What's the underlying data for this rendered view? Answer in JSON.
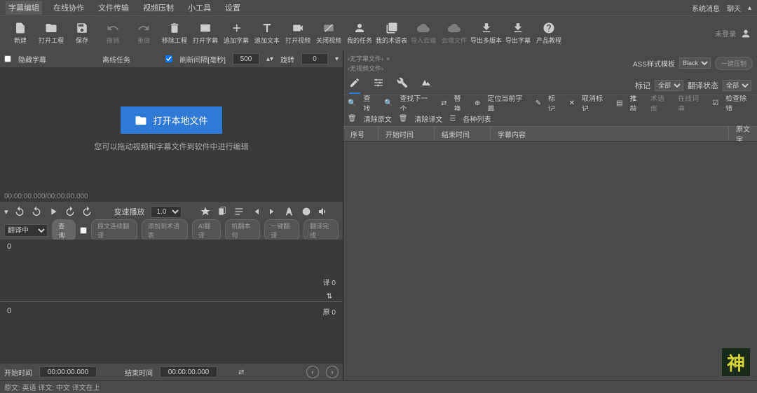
{
  "top": {
    "tabs": [
      "字幕编辑",
      "在线协作",
      "文件传输",
      "视频压制",
      "小工具",
      "设置"
    ],
    "right": {
      "msg": "系统消息",
      "chat": "聊天",
      "login": "未登录"
    }
  },
  "toolbar": [
    {
      "label": "新建"
    },
    {
      "label": "打开工程"
    },
    {
      "label": "保存"
    },
    {
      "label": "撤销",
      "disabled": true
    },
    {
      "label": "重做",
      "disabled": true
    },
    {
      "label": "移除工程"
    },
    {
      "label": "打开字幕"
    },
    {
      "label": "追加字幕"
    },
    {
      "label": "追加文本"
    },
    {
      "label": "打开视频"
    },
    {
      "label": "关闭视频"
    },
    {
      "label": "我的任务"
    },
    {
      "label": "我的术语表"
    },
    {
      "label": "导入云端",
      "disabled": true
    },
    {
      "label": "云端文件",
      "disabled": true
    },
    {
      "label": "导出多版本"
    },
    {
      "label": "导出字幕"
    },
    {
      "label": "产品教程"
    }
  ],
  "left": {
    "hide_sub": "隐藏字幕",
    "offline": "离线任务",
    "refresh": "刷新间隔[毫秒]",
    "refresh_val": "500",
    "rotate": "旋转",
    "rotate_val": "0",
    "open_local": "打开本地文件",
    "hint": "您可以拖动视频和字幕文件到软件中进行编辑",
    "timecode": "00:00:00.000/00:00:00.000",
    "speed_label": "变速播放",
    "speed_val": "1.0",
    "translating": "翻译中",
    "query": "查询",
    "pills": [
      "原文连续翻译",
      "添加到术语表",
      "AI翻译",
      "机翻本句",
      "一键翻译",
      "翻译完成"
    ],
    "wf_top_num": "0",
    "wf_bot_num": "0",
    "t_label_trans": "译 0",
    "t_label_orig": "原 0",
    "start_time_lbl": "开始时间",
    "start_time_val": "00:00:00.000",
    "end_time_lbl": "结束时间",
    "end_time_val": "00:00:00.000"
  },
  "right": {
    "tab1": "无字幕文件",
    "tab2": "无视频文件",
    "ass_style": "ASS样式模板",
    "ass_val": "Black",
    "compress": "一键压制",
    "filters": {
      "tag_lbl": "标记",
      "all": "全部",
      "trans_status": "翻译状态"
    },
    "row1": [
      "查找",
      "查找下一个",
      "替换",
      "定位当前字幕",
      "标记",
      "取消标记",
      "推敲",
      "术语库",
      "在线词典",
      "检查除错"
    ],
    "row2": [
      "清除原文",
      "清除译文",
      "各种列表"
    ],
    "cols": [
      "序号",
      "开始时间",
      "结束时间",
      "字幕内容",
      "原文字"
    ]
  },
  "status": "原文: 英语  译文: 中文  译文在上",
  "logo": "神"
}
